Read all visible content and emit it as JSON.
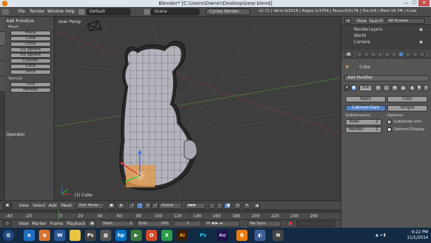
{
  "window": {
    "title": "Blender* [C:\\Users\\Owner\\Desktop\\bear.blend]",
    "min": "—",
    "max": "☐",
    "close": "✕"
  },
  "menu": {
    "file": "File",
    "render": "Render",
    "window": "Window",
    "help": "Help"
  },
  "layout": {
    "screen": "Default",
    "scene": "Scene",
    "engine": "Cycles Render"
  },
  "stats": "v2.72 | Verts:0/2016 | Edges:1/3756 | Faces:0/2178 | Tris:2/4 | Mem:16.7M | Cube",
  "toolshelf": {
    "add_mesh": "Add Primitive",
    "mesh_label": "Mesh",
    "buttons": [
      "Plane",
      "Cube",
      "Circle",
      "UV Sphere",
      "Ico Sphere",
      "Cylinder",
      "Cone",
      "Torus"
    ],
    "special_label": "Special",
    "special_buttons": [
      "Grid",
      "Monkey"
    ],
    "operator": "Operator"
  },
  "viewport": {
    "view_name": "User Persp",
    "object_label": "(1) Cube"
  },
  "viewport_header": {
    "view": "View",
    "select": "Select",
    "add": "Add",
    "mesh": "Mesh",
    "mode": "Edit Mode",
    "orientation": "Global"
  },
  "timeline": {
    "ticks": [
      "-40",
      "-20",
      "0",
      "20",
      "40",
      "60",
      "80",
      "100",
      "120",
      "140",
      "160",
      "180",
      "200",
      "220",
      "240",
      "260"
    ]
  },
  "timeline_header": {
    "view": "View",
    "marker": "Marker",
    "frame": "Frame",
    "playback": "Playback",
    "start": "Start:",
    "start_val": "1",
    "end": "End:",
    "end_val": "250",
    "current": "1",
    "sync": "No Sync"
  },
  "outliner": {
    "view": "View",
    "search": "Search",
    "scope": "All Scenes",
    "items": [
      "RenderLayers",
      "World",
      "Camera"
    ]
  },
  "properties": {
    "object_name": "Cube",
    "add_modifier": "Add Modifier",
    "mod_name": "Sub",
    "apply": "Apply",
    "copy": "Copy",
    "catmull": "Catmull-Clark",
    "simple": "Simple",
    "subdivisions": "Subdivisions:",
    "options": "Options:",
    "view_label": "View:",
    "view_val": "2",
    "render_label": "Render:",
    "render_val": "2",
    "subdiv_uvs": "Subdivide UVs",
    "optimal": "Optimal Display"
  },
  "taskbar": {
    "time": "9:22 PM",
    "date": "11/1/2014",
    "apps": [
      "e",
      "◉",
      "W",
      "",
      "Ps",
      "hp",
      "▶",
      "Ai",
      "Ps",
      "Ae",
      "B",
      "◐",
      "N"
    ]
  },
  "colors": {
    "accent": "#5680c2",
    "selected_face": "#e09a4e",
    "mesh": "#b0b0b8",
    "taskbar": "#142b46"
  }
}
